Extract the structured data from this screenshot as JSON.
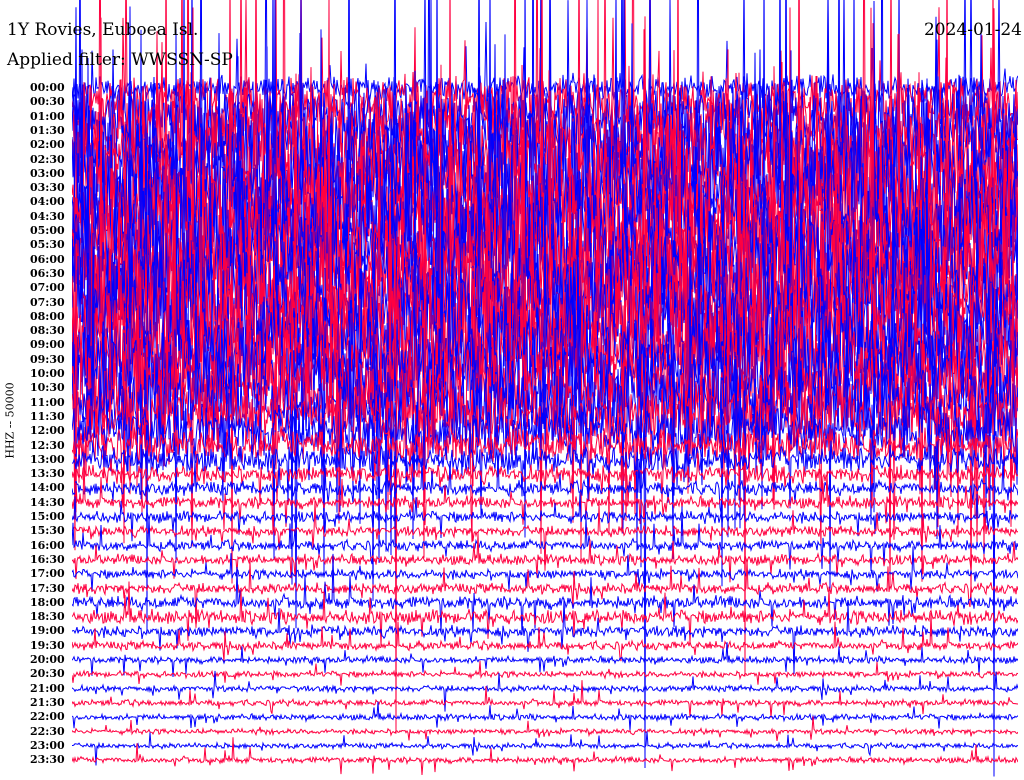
{
  "chart_data": {
    "type": "line",
    "title": "1Y Rovies, Euboea Isl.",
    "subtitle": "Applied filter: WWSSN-SP",
    "date": "2024-01-24",
    "ylabel": "HHZ -- 50000",
    "row_labels": [
      "00:00",
      "00:30",
      "01:00",
      "01:30",
      "02:00",
      "02:30",
      "03:00",
      "03:30",
      "04:00",
      "04:30",
      "05:00",
      "05:30",
      "06:00",
      "06:30",
      "07:00",
      "07:30",
      "08:00",
      "08:30",
      "09:00",
      "09:30",
      "10:00",
      "10:30",
      "11:00",
      "11:30",
      "12:00",
      "12:30",
      "13:00",
      "13:30",
      "14:00",
      "14:30",
      "15:00",
      "15:30",
      "16:00",
      "16:30",
      "17:00",
      "17:30",
      "18:00",
      "18:30",
      "19:00",
      "19:30",
      "20:00",
      "20:30",
      "21:00",
      "21:30",
      "22:00",
      "22:30",
      "23:00",
      "23:30"
    ],
    "series_colors": [
      "#0000ff",
      "#ff0040"
    ],
    "relative_amplitude": [
      3,
      6,
      8,
      10,
      12,
      12,
      14,
      14,
      14,
      14,
      14,
      14,
      14,
      14,
      14,
      14,
      14,
      14,
      12,
      12,
      12,
      10,
      10,
      8,
      6,
      4,
      3,
      2,
      1.6,
      1.4,
      1.3,
      1.2,
      1.2,
      1.2,
      1.1,
      1.2,
      1.5,
      1.6,
      1.3,
      1.0,
      0.8,
      0.7,
      0.7,
      0.7,
      0.7,
      0.6,
      0.6,
      0.7
    ]
  }
}
